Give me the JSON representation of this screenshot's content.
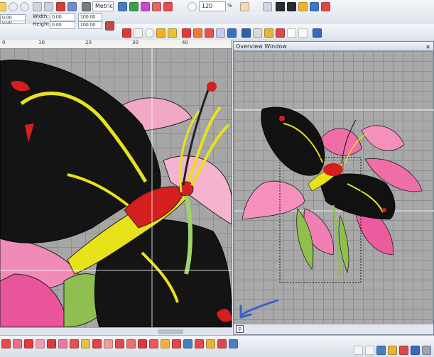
{
  "toolbar": {
    "units_select": "Metric",
    "zoom_value": "120",
    "zoom_unit": "%",
    "x_value": "0.00",
    "y_value": "0.00",
    "width_label": "Width:",
    "height_label": "Height:",
    "width_value": "0.00",
    "height_value": "0.00",
    "width_pct": "100.00",
    "height_pct": "100.00"
  },
  "ruler": {
    "ticks": [
      "0",
      "10",
      "20",
      "30",
      "40"
    ]
  },
  "overview": {
    "title": "Overview Window",
    "pin": "✕"
  },
  "colors": {
    "accent": "#3a60c8",
    "canvas_bg": "#a6a6a6",
    "butterfly": "#111111",
    "flower": "#f06ea8",
    "leaf": "#8fbf4e",
    "yellow": "#e8e21a",
    "red": "#d51f1f"
  }
}
